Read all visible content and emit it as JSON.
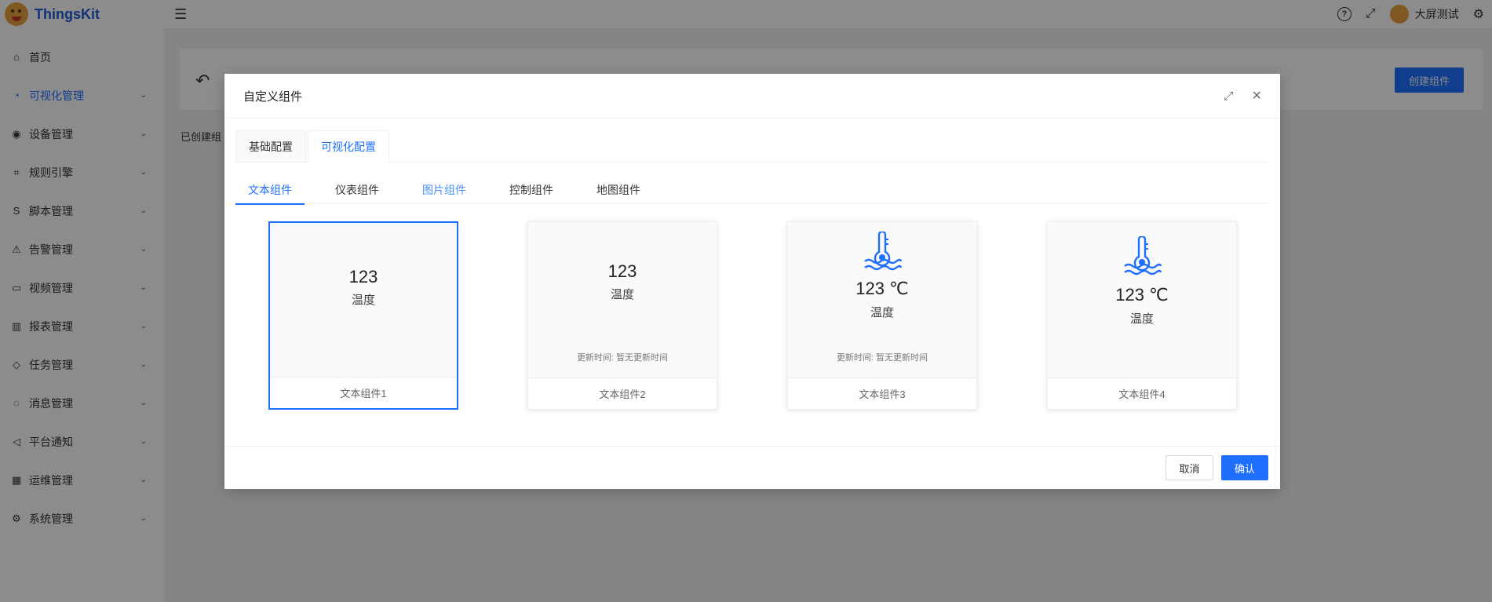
{
  "app": {
    "logo_text": "ThingsKit"
  },
  "sidebar": {
    "items": [
      {
        "label": "首页",
        "icon": "home-icon",
        "active": false,
        "has_arrow": false
      },
      {
        "label": "可视化管理",
        "icon": "dashboard-icon",
        "active": true,
        "has_arrow": true
      },
      {
        "label": "设备管理",
        "icon": "device-icon",
        "active": false,
        "has_arrow": true
      },
      {
        "label": "规则引擎",
        "icon": "rule-icon",
        "active": false,
        "has_arrow": true
      },
      {
        "label": "脚本管理",
        "icon": "script-icon",
        "active": false,
        "has_arrow": true
      },
      {
        "label": "告警管理",
        "icon": "alarm-icon",
        "active": false,
        "has_arrow": true
      },
      {
        "label": "视频管理",
        "icon": "video-icon",
        "active": false,
        "has_arrow": true
      },
      {
        "label": "报表管理",
        "icon": "report-icon",
        "active": false,
        "has_arrow": true
      },
      {
        "label": "任务管理",
        "icon": "task-icon",
        "active": false,
        "has_arrow": true
      },
      {
        "label": "消息管理",
        "icon": "message-icon",
        "active": false,
        "has_arrow": true
      },
      {
        "label": "平台通知",
        "icon": "notification-icon",
        "active": false,
        "has_arrow": true
      },
      {
        "label": "运维管理",
        "icon": "ops-icon",
        "active": false,
        "has_arrow": true
      },
      {
        "label": "系统管理",
        "icon": "gear-icon",
        "active": false,
        "has_arrow": true
      }
    ]
  },
  "header": {
    "user_name": "大屏测试"
  },
  "background": {
    "create_button": "创建组件",
    "created_text": "已创建组"
  },
  "modal": {
    "title": "自定义组件",
    "card_tabs": [
      {
        "label": "基础配置",
        "active": false
      },
      {
        "label": "可视化配置",
        "active": true
      }
    ],
    "line_tabs": [
      {
        "label": "文本组件",
        "active": true
      },
      {
        "label": "仪表组件",
        "active": false
      },
      {
        "label": "图片组件",
        "active": false
      },
      {
        "label": "控制组件",
        "active": false
      },
      {
        "label": "地图组件",
        "active": false
      }
    ],
    "cards": [
      {
        "name": "文本组件1",
        "value": "123",
        "label": "温度",
        "update_text": "",
        "selected": true
      },
      {
        "name": "文本组件2",
        "value": "123",
        "label": "温度",
        "update_text": "更新时间: 暂无更新时间",
        "selected": false
      },
      {
        "name": "文本组件3",
        "value": "123 ℃",
        "label": "温度",
        "update_text": "更新时间: 暂无更新时间",
        "selected": false
      },
      {
        "name": "文本组件4",
        "value": "123 ℃",
        "label": "温度",
        "update_text": "",
        "selected": false
      }
    ],
    "cancel_label": "取消",
    "ok_label": "确认"
  },
  "colors": {
    "primary": "#1e6fff",
    "sidebar_bg": "#ffffff",
    "overlay": "rgba(0,0,0,0.45)"
  }
}
